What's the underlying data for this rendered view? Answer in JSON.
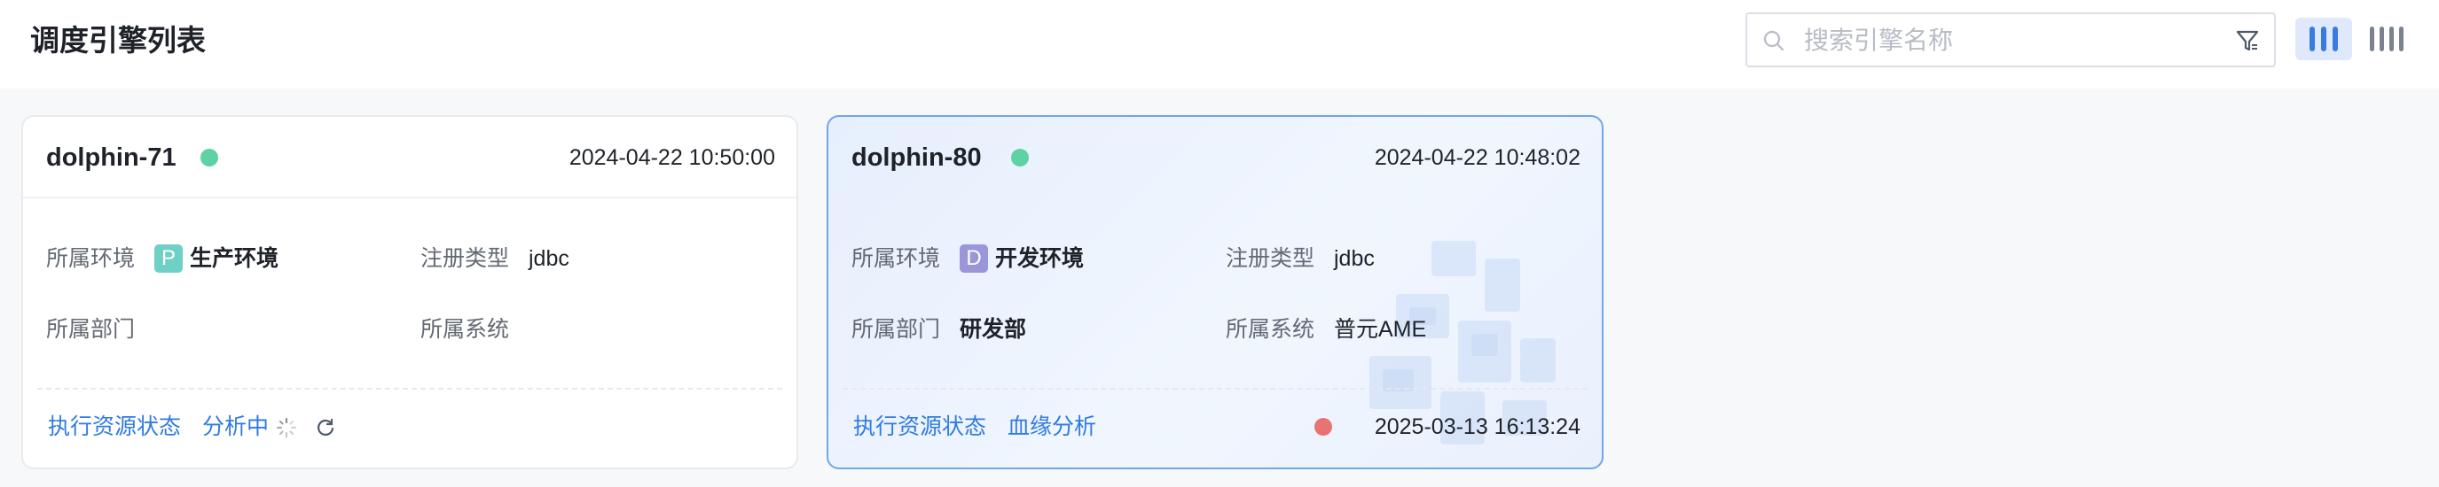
{
  "page": {
    "title": "调度引擎列表"
  },
  "search": {
    "placeholder": "搜索引擎名称",
    "value": ""
  },
  "view_toggle": {
    "selected": "3-column"
  },
  "cards": [
    {
      "name": "dolphin-71",
      "status_dot_color": "#5ed1a5",
      "created_at": "2024-04-22 10:50:00",
      "fields": {
        "env_label": "所属环境",
        "env_badge": "P",
        "env_badge_color": "#6fd0c8",
        "env_value": "生产环境",
        "reg_label": "注册类型",
        "reg_value": "jdbc",
        "dept_label": "所属部门",
        "dept_value": "",
        "sys_label": "所属系统",
        "sys_value": ""
      },
      "actions": {
        "resource_status": "执行资源状态",
        "analyzing": "分析中"
      },
      "selected": false
    },
    {
      "name": "dolphin-80",
      "status_dot_color": "#5ed1a5",
      "created_at": "2024-04-22 10:48:02",
      "fields": {
        "env_label": "所属环境",
        "env_badge": "D",
        "env_badge_color": "#9b96d8",
        "env_value": "开发环境",
        "reg_label": "注册类型",
        "reg_value": "jdbc",
        "dept_label": "所属部门",
        "dept_value": "研发部",
        "sys_label": "所属系统",
        "sys_value": "普元AME"
      },
      "actions": {
        "resource_status": "执行资源状态",
        "lineage": "血缘分析"
      },
      "lineage_status_color": "#e87373",
      "lineage_time": "2025-03-13 16:13:24",
      "selected": true
    }
  ]
}
